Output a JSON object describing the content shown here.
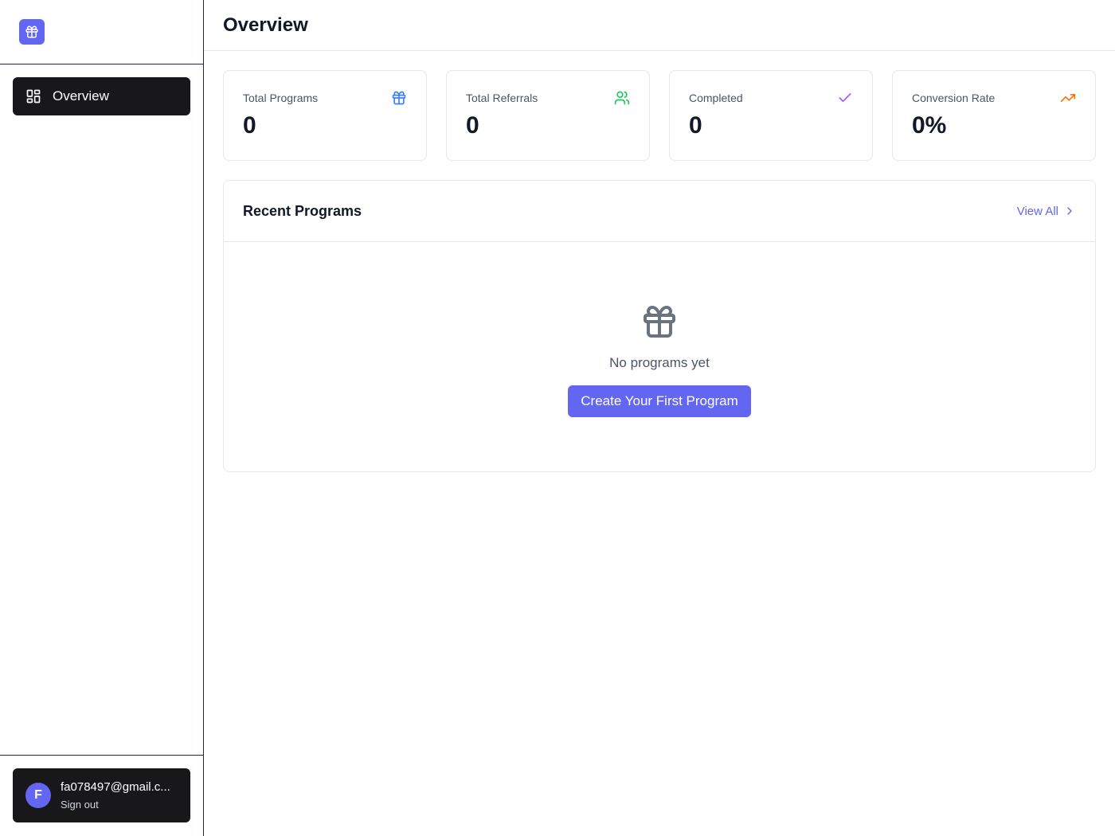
{
  "sidebar": {
    "logo_icon": "gift-icon",
    "nav": [
      {
        "label": "Overview",
        "icon": "dashboard-grid-icon",
        "active": true
      }
    ],
    "user": {
      "avatar_initial": "F",
      "email": "fa078497@gmail.c...",
      "sign_out_label": "Sign out"
    }
  },
  "header": {
    "title": "Overview"
  },
  "stats": [
    {
      "label": "Total Programs",
      "value": "0",
      "icon": "gift-icon",
      "color": "#3b82f6"
    },
    {
      "label": "Total Referrals",
      "value": "0",
      "icon": "users-icon",
      "color": "#22c55e"
    },
    {
      "label": "Completed",
      "value": "0",
      "icon": "check-icon",
      "color": "#a855f7"
    },
    {
      "label": "Conversion Rate",
      "value": "0%",
      "icon": "trending-up-icon",
      "color": "#f97316"
    }
  ],
  "recent_programs": {
    "title": "Recent Programs",
    "view_all_label": "View All",
    "empty_icon": "gift-icon",
    "empty_text": "No programs yet",
    "cta_label": "Create Your First Program"
  },
  "colors": {
    "accent": "#6366f1",
    "dark": "#18181b"
  }
}
